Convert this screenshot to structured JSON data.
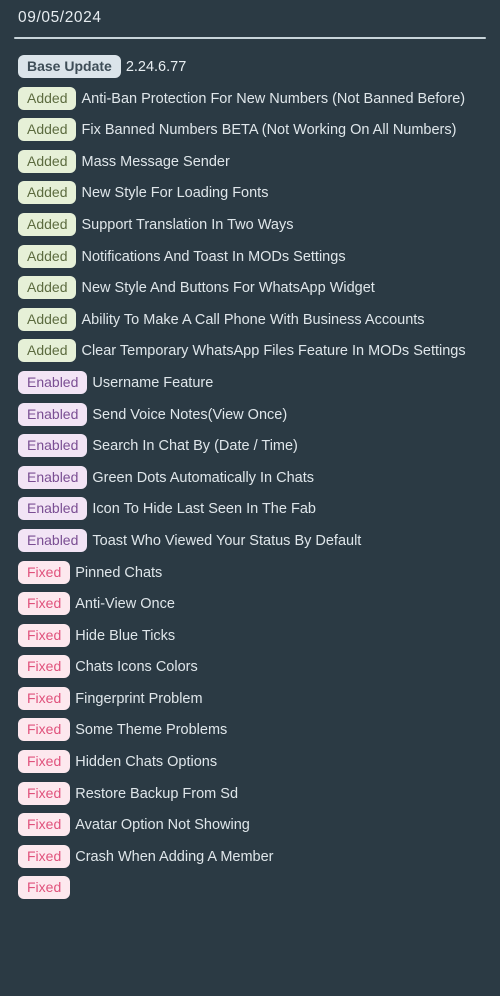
{
  "header": {
    "date": "09/05/2024"
  },
  "changelog": {
    "entries": [
      {
        "tag": "Base Update",
        "tag_type": "base",
        "text": "2.24.6.77"
      },
      {
        "tag": "Added",
        "tag_type": "added",
        "text": "Anti-Ban Protection For New Numbers (Not Banned Before)"
      },
      {
        "tag": "Added",
        "tag_type": "added",
        "text": "Fix Banned Numbers BETA (Not Working On All Numbers)"
      },
      {
        "tag": "Added",
        "tag_type": "added",
        "text": "Mass Message Sender"
      },
      {
        "tag": "Added",
        "tag_type": "added",
        "text": "New Style For Loading Fonts"
      },
      {
        "tag": "Added",
        "tag_type": "added",
        "text": "Support Translation In Two Ways"
      },
      {
        "tag": "Added",
        "tag_type": "added",
        "text": "Notifications And Toast In MODs Settings"
      },
      {
        "tag": "Added",
        "tag_type": "added",
        "text": "New Style And Buttons For WhatsApp Widget"
      },
      {
        "tag": "Added",
        "tag_type": "added",
        "text": "Ability To Make A Call Phone With Business Accounts"
      },
      {
        "tag": "Added",
        "tag_type": "added",
        "text": "Clear Temporary WhatsApp Files Feature In MODs Settings"
      },
      {
        "tag": "Enabled",
        "tag_type": "enabled",
        "text": "Username Feature"
      },
      {
        "tag": "Enabled",
        "tag_type": "enabled",
        "text": "Send Voice Notes(View Once)"
      },
      {
        "tag": "Enabled",
        "tag_type": "enabled",
        "text": "Search In Chat By (Date / Time)"
      },
      {
        "tag": "Enabled",
        "tag_type": "enabled",
        "text": "Green Dots Automatically In Chats"
      },
      {
        "tag": "Enabled",
        "tag_type": "enabled",
        "text": "Icon To Hide Last Seen In The Fab"
      },
      {
        "tag": "Enabled",
        "tag_type": "enabled",
        "text": "Toast Who Viewed Your Status By Default"
      },
      {
        "tag": "Fixed",
        "tag_type": "fixed",
        "text": "Pinned Chats"
      },
      {
        "tag": "Fixed",
        "tag_type": "fixed",
        "text": "Anti-View Once"
      },
      {
        "tag": "Fixed",
        "tag_type": "fixed",
        "text": "Hide Blue Ticks"
      },
      {
        "tag": "Fixed",
        "tag_type": "fixed",
        "text": "Chats Icons Colors"
      },
      {
        "tag": "Fixed",
        "tag_type": "fixed",
        "text": "Fingerprint Problem"
      },
      {
        "tag": "Fixed",
        "tag_type": "fixed",
        "text": "Some Theme Problems"
      },
      {
        "tag": "Fixed",
        "tag_type": "fixed",
        "text": "Hidden Chats Options"
      },
      {
        "tag": "Fixed",
        "tag_type": "fixed",
        "text": "Restore Backup From Sd"
      },
      {
        "tag": "Fixed",
        "tag_type": "fixed",
        "text": "Avatar Option Not Showing"
      },
      {
        "tag": "Fixed",
        "tag_type": "fixed",
        "text": "Crash When Adding A Member"
      },
      {
        "tag": "Fixed",
        "tag_type": "fixed",
        "text": ""
      }
    ]
  },
  "colors": {
    "background": "#2b3a44",
    "divider": "#c8d4da",
    "text": "#dfe6ea",
    "badge_base_bg": "#dbe4ea",
    "badge_base_fg": "#3e4d57",
    "badge_added_bg": "#e6f0d7",
    "badge_added_fg": "#5c6b3f",
    "badge_enabled_bg": "#f2e4f5",
    "badge_enabled_fg": "#7a4e93",
    "badge_fixed_bg": "#fde8ee",
    "badge_fixed_fg": "#e0527c"
  }
}
